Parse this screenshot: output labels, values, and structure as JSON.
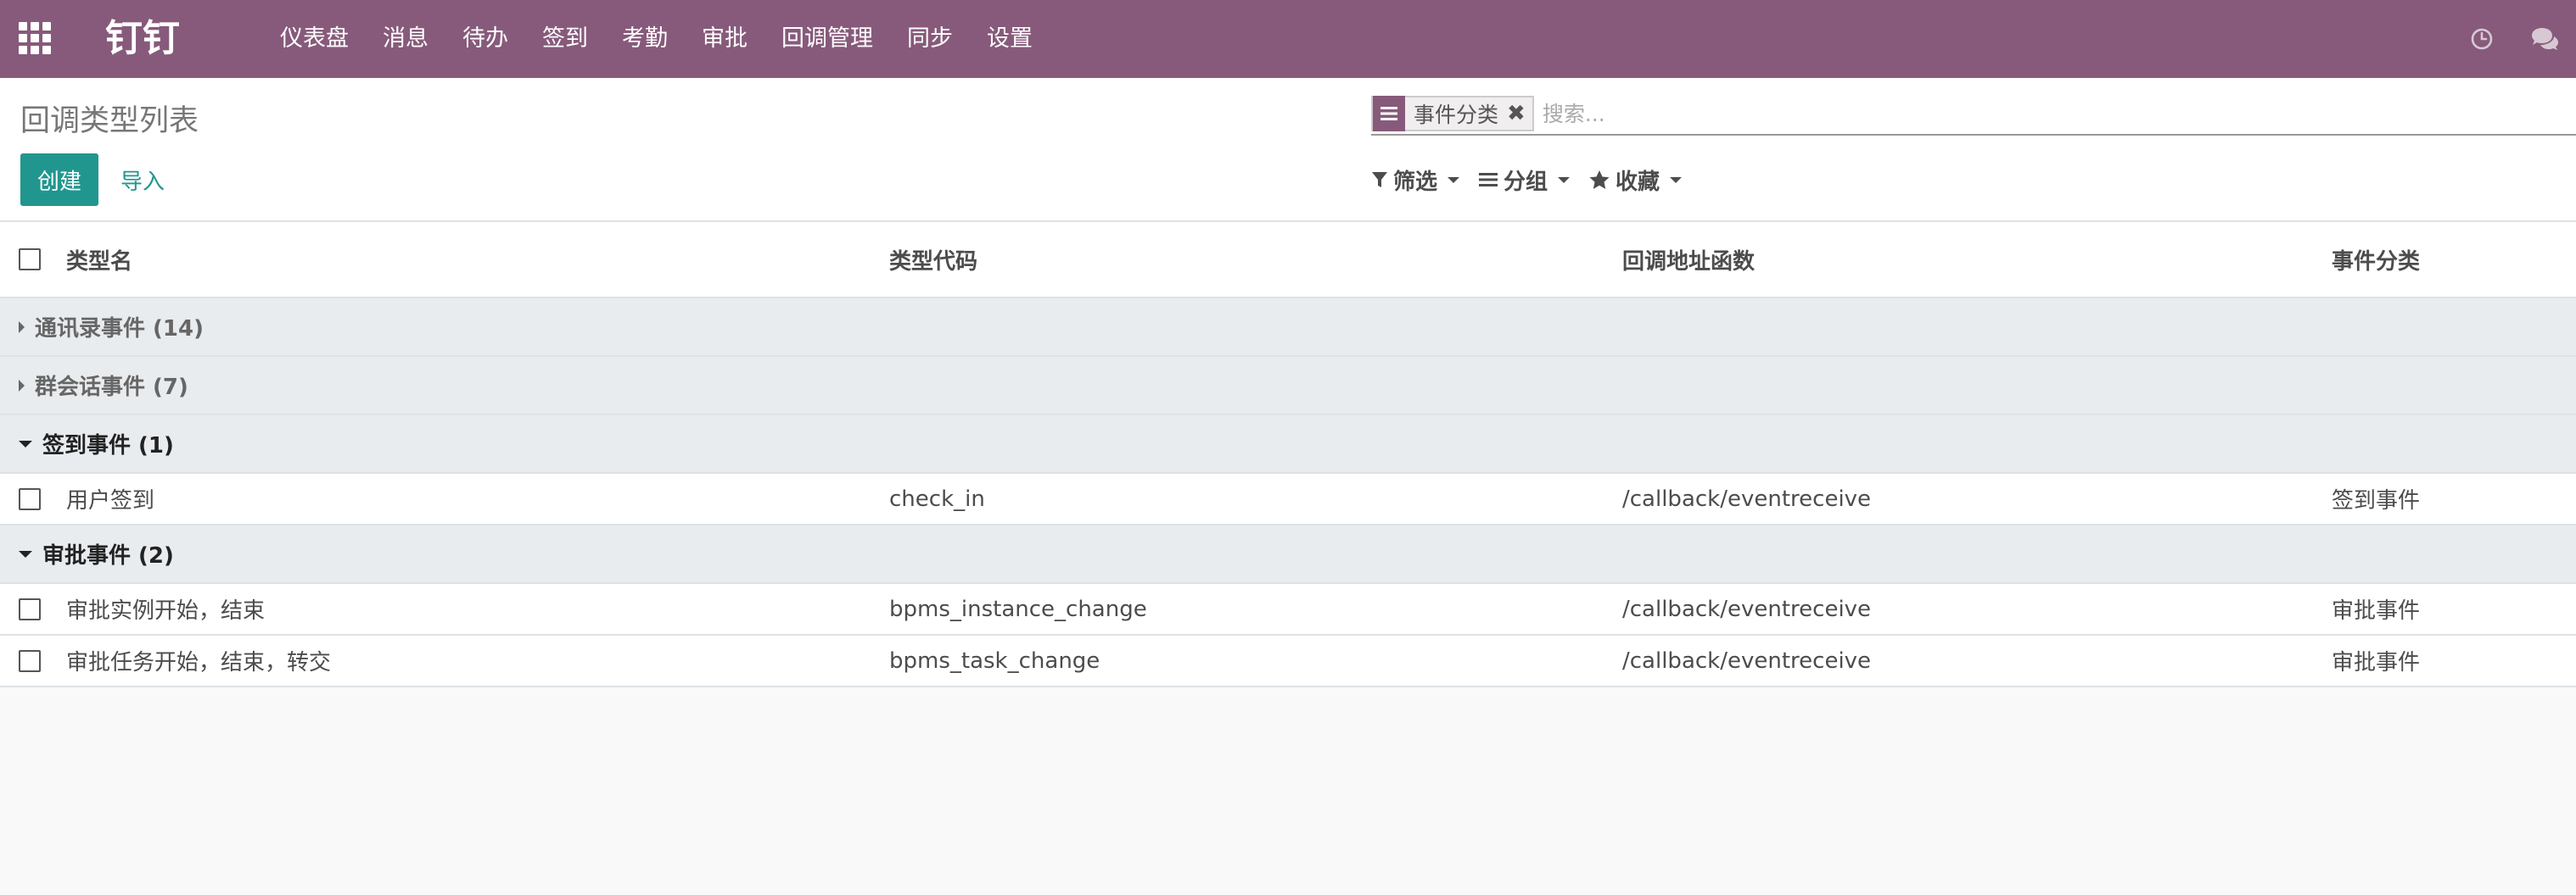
{
  "navbar": {
    "brand": "钉钉",
    "menu": [
      "仪表盘",
      "消息",
      "待办",
      "签到",
      "考勤",
      "审批",
      "回调管理",
      "同步",
      "设置"
    ]
  },
  "control_panel": {
    "title": "回调类型列表",
    "create_label": "创建",
    "import_label": "导入",
    "search": {
      "facet_value": "事件分类",
      "placeholder": "搜索..."
    },
    "filters_label": "筛选",
    "groupby_label": "分组",
    "favorites_label": "收藏"
  },
  "table": {
    "columns": [
      "类型名",
      "类型代码",
      "回调地址函数",
      "事件分类"
    ],
    "groups": [
      {
        "label": "通讯录事件 (14)",
        "open": false,
        "rows": []
      },
      {
        "label": "群会话事件 (7)",
        "open": false,
        "rows": []
      },
      {
        "label": "签到事件 (1)",
        "open": true,
        "rows": [
          [
            "用户签到",
            "check_in",
            "/callback/eventreceive",
            "签到事件"
          ]
        ]
      },
      {
        "label": "审批事件 (2)",
        "open": true,
        "rows": [
          [
            "审批实例开始，结束",
            "bpms_instance_change",
            "/callback/eventreceive",
            "审批事件"
          ],
          [
            "审批任务开始，结束，转交",
            "bpms_task_change",
            "/callback/eventreceive",
            "审批事件"
          ]
        ]
      }
    ]
  },
  "colors": {
    "navbar": "#875a7b",
    "primary": "#21968f",
    "group_bg": "#e9ecef"
  }
}
